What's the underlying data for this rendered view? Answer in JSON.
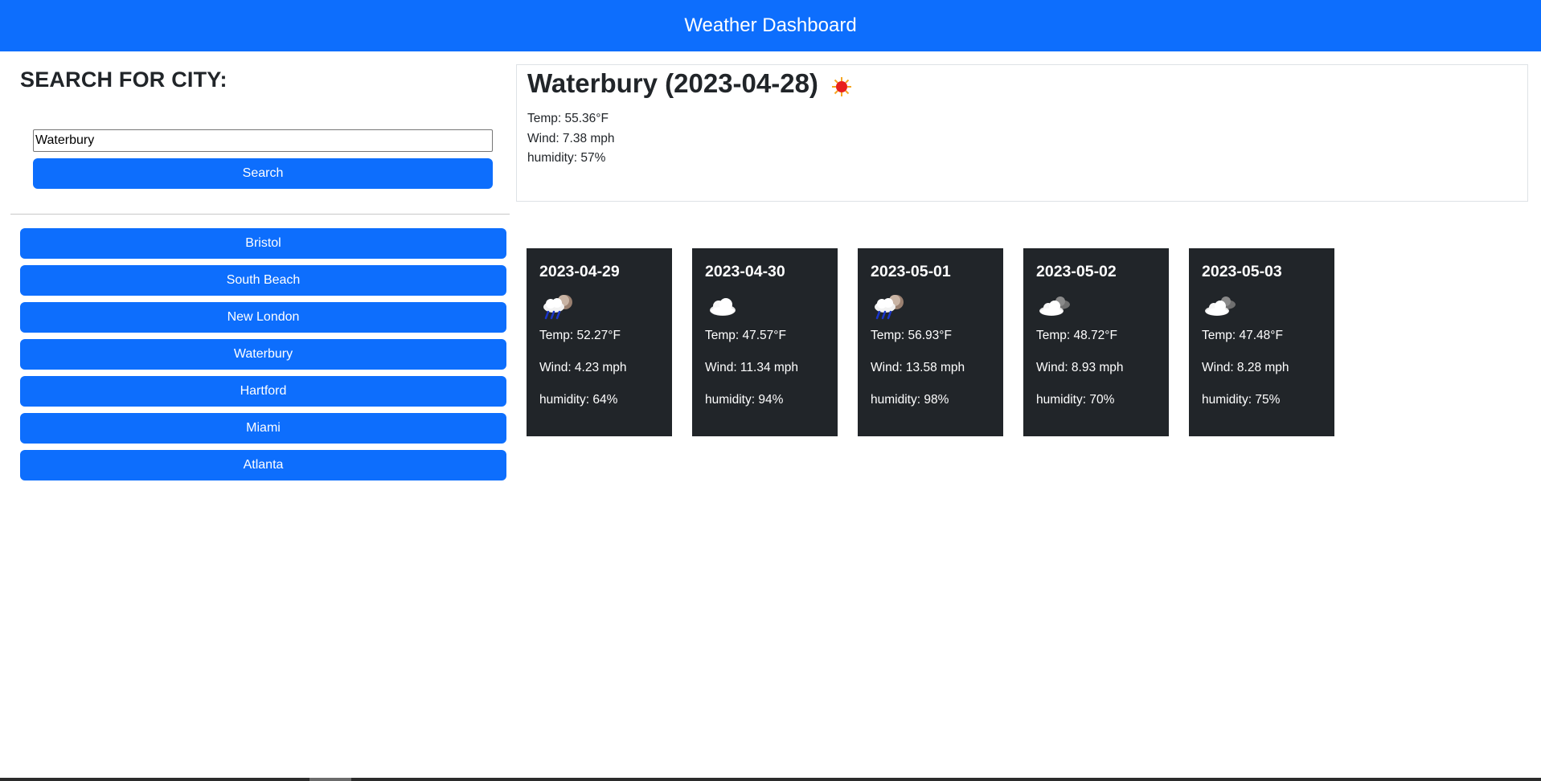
{
  "header": {
    "title": "Weather Dashboard"
  },
  "sidebar": {
    "heading": "SEARCH FOR CITY:",
    "search": {
      "value": "Waterbury",
      "button_label": "Search"
    },
    "history": [
      {
        "label": "Bristol"
      },
      {
        "label": "South Beach"
      },
      {
        "label": "New London"
      },
      {
        "label": "Waterbury"
      },
      {
        "label": "Hartford"
      },
      {
        "label": "Miami"
      },
      {
        "label": "Atlanta"
      }
    ]
  },
  "current": {
    "title": "Waterbury (2023-04-28)",
    "icon": "sun-icon",
    "temp": "Temp: 55.36°F",
    "wind": "Wind: 7.38 mph",
    "humidity": "humidity: 57%"
  },
  "forecast": [
    {
      "date": "2023-04-29",
      "icon": "rain-icon",
      "temp": "Temp: 52.27°F",
      "wind": "Wind: 4.23 mph",
      "humidity": "humidity: 64%"
    },
    {
      "date": "2023-04-30",
      "icon": "cloud-icon",
      "temp": "Temp: 47.57°F",
      "wind": "Wind: 11.34 mph",
      "humidity": "humidity: 94%"
    },
    {
      "date": "2023-05-01",
      "icon": "rain-icon",
      "temp": "Temp: 56.93°F",
      "wind": "Wind: 13.58 mph",
      "humidity": "humidity: 98%"
    },
    {
      "date": "2023-05-02",
      "icon": "broken-clouds-icon",
      "temp": "Temp: 48.72°F",
      "wind": "Wind: 8.93 mph",
      "humidity": "humidity: 70%"
    },
    {
      "date": "2023-05-03",
      "icon": "broken-clouds-icon",
      "temp": "Temp: 47.48°F",
      "wind": "Wind: 8.28 mph",
      "humidity": "humidity: 75%"
    }
  ],
  "colors": {
    "primary": "#0d6efd",
    "card_bg": "#212529",
    "text": "#212529"
  }
}
